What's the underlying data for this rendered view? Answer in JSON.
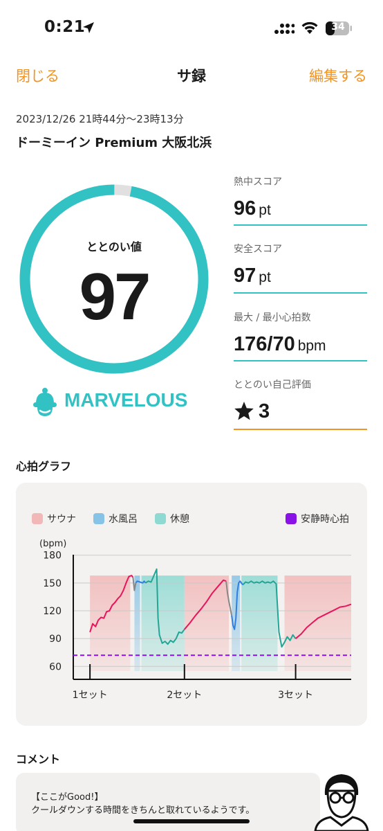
{
  "status_bar": {
    "time": "0:21",
    "battery": "34"
  },
  "nav": {
    "close": "閉じる",
    "title": "サ録",
    "edit": "編集する"
  },
  "session": {
    "datetime": "2023/12/26 21時44分〜23時13分",
    "place": "ドーミーイン Premium 大阪北浜"
  },
  "totonoi": {
    "label": "ととのい値",
    "value": "97",
    "value_fraction": 0.97,
    "rank": "MARVELOUS",
    "accent_color": "#33c2c4"
  },
  "scores": [
    {
      "label": "熱中スコア",
      "value": "96",
      "unit": "pt"
    },
    {
      "label": "安全スコア",
      "value": "97",
      "unit": "pt"
    },
    {
      "label": "最大 / 最小心拍数",
      "value": "176/70",
      "unit": "bpm"
    },
    {
      "label": "ととのい自己評価",
      "value": "3",
      "icon": "star-icon"
    }
  ],
  "graph": {
    "title": "心拍グラフ",
    "legend": {
      "sauna": "サウナ",
      "water": "水風呂",
      "rest": "休憩",
      "resting_hr": "安静時心拍"
    },
    "colors": {
      "sauna": "#f2b8b8",
      "water": "#87c3e6",
      "rest": "#8ed9d2",
      "resting_hr": "#8a12e6",
      "line_sauna": "#e8155c",
      "line_water": "#2f7fe0",
      "line_rest": "#23a596"
    }
  },
  "chart_data": {
    "type": "line",
    "ylabel": "(bpm)",
    "yticks": [
      "180",
      "150",
      "120",
      "90",
      "60"
    ],
    "ylim": [
      55,
      185
    ],
    "xlim": [
      0,
      100
    ],
    "categories": [
      "1セット",
      "2セット",
      "3セット"
    ],
    "category_positions": [
      6,
      40,
      80
    ],
    "resting_hr": 72,
    "grid": true,
    "phases": [
      {
        "type": "sauna",
        "start": 6,
        "end": 20.5
      },
      {
        "type": "water",
        "start": 22,
        "end": 24
      },
      {
        "type": "rest",
        "start": 24.5,
        "end": 40
      },
      {
        "type": "sauna",
        "start": 40,
        "end": 56
      },
      {
        "type": "water",
        "start": 57,
        "end": 60
      },
      {
        "type": "rest",
        "start": 60.5,
        "end": 73.5
      },
      {
        "type": "sauna",
        "start": 76,
        "end": 100
      }
    ],
    "series": [
      {
        "phase": "sauna",
        "points": [
          [
            6,
            97
          ],
          [
            7,
            106
          ],
          [
            8,
            103
          ],
          [
            9,
            110
          ],
          [
            10,
            113
          ],
          [
            11,
            112
          ],
          [
            12,
            119
          ],
          [
            13,
            120
          ],
          [
            14,
            126
          ],
          [
            15,
            129
          ],
          [
            16,
            133
          ],
          [
            17,
            136
          ],
          [
            18,
            142
          ],
          [
            19,
            150
          ],
          [
            20,
            157
          ],
          [
            21,
            158
          ],
          [
            21.5,
            156
          ]
        ]
      },
      {
        "phase": "transition",
        "points": [
          [
            21.5,
            156
          ],
          [
            22,
            142
          ],
          [
            22.5,
            150
          ]
        ]
      },
      {
        "phase": "water",
        "points": [
          [
            22.5,
            150
          ],
          [
            23,
            152
          ],
          [
            24,
            151
          ],
          [
            25,
            150
          ],
          [
            25.5,
            152
          ],
          [
            26,
            150
          ]
        ]
      },
      {
        "phase": "rest",
        "points": [
          [
            26,
            150
          ],
          [
            27,
            152
          ],
          [
            28,
            151
          ],
          [
            29,
            158
          ],
          [
            30,
            165
          ],
          [
            30.5,
            112
          ],
          [
            31,
            94
          ],
          [
            32,
            85
          ],
          [
            33,
            87
          ],
          [
            34,
            84
          ],
          [
            35,
            88
          ],
          [
            36,
            86
          ],
          [
            37,
            90
          ],
          [
            38,
            97
          ],
          [
            39,
            96
          ],
          [
            40,
            100
          ]
        ]
      },
      {
        "phase": "sauna",
        "points": [
          [
            40,
            100
          ],
          [
            42,
            107
          ],
          [
            44,
            115
          ],
          [
            46,
            122
          ],
          [
            48,
            130
          ],
          [
            50,
            139
          ],
          [
            52,
            146
          ],
          [
            54,
            153
          ],
          [
            55,
            152
          ]
        ]
      },
      {
        "phase": "transition",
        "points": [
          [
            55,
            152
          ],
          [
            55.5,
            139
          ],
          [
            56,
            130
          ],
          [
            57,
            115
          ]
        ]
      },
      {
        "phase": "water",
        "points": [
          [
            57,
            115
          ],
          [
            57.5,
            104
          ],
          [
            58,
            100
          ],
          [
            58.5,
            112
          ],
          [
            59,
            140
          ],
          [
            59.5,
            150
          ],
          [
            60,
            152
          ],
          [
            61,
            148
          ]
        ]
      },
      {
        "phase": "rest",
        "points": [
          [
            61,
            148
          ],
          [
            62,
            151
          ],
          [
            63,
            150
          ],
          [
            64,
            152
          ],
          [
            65,
            150
          ],
          [
            66,
            151
          ],
          [
            67,
            150
          ],
          [
            68,
            152
          ],
          [
            69,
            150
          ],
          [
            70,
            151
          ],
          [
            71,
            150
          ],
          [
            72,
            152
          ],
          [
            73,
            149
          ],
          [
            74,
            97
          ],
          [
            75,
            81
          ],
          [
            76,
            86
          ],
          [
            77,
            92
          ],
          [
            78,
            88
          ],
          [
            79,
            94
          ],
          [
            80,
            90
          ]
        ]
      },
      {
        "phase": "sauna",
        "points": [
          [
            80,
            90
          ],
          [
            82,
            95
          ],
          [
            84,
            102
          ],
          [
            86,
            107
          ],
          [
            88,
            112
          ],
          [
            90,
            115
          ],
          [
            92,
            118
          ],
          [
            94,
            121
          ],
          [
            96,
            124
          ],
          [
            98,
            125
          ],
          [
            100,
            127
          ]
        ]
      }
    ]
  },
  "comment": {
    "title": "コメント",
    "line1": "【ここがGood!】",
    "line2": "クールダウンする時間をきちんと取れているようです。"
  }
}
